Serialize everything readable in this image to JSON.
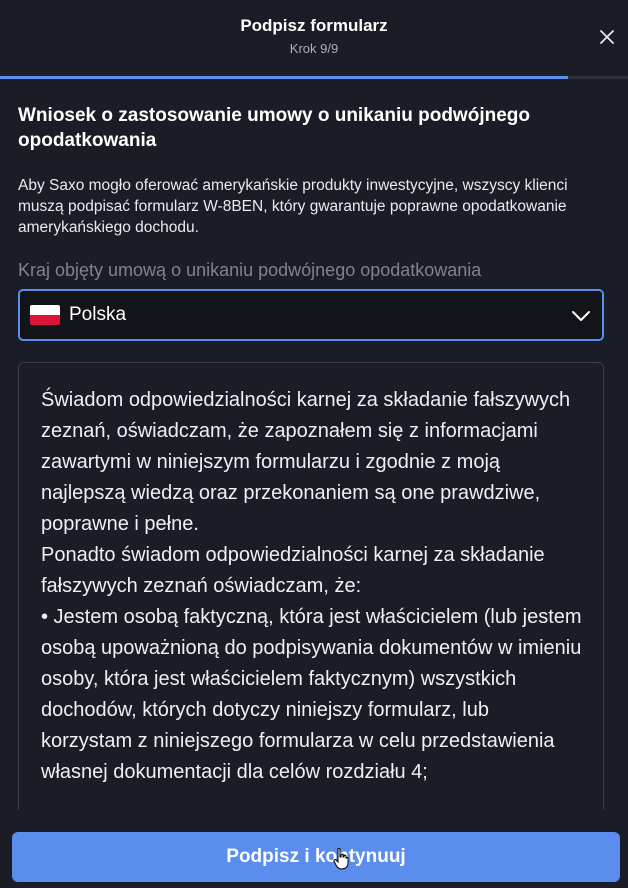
{
  "header": {
    "title": "Podpisz formularz",
    "step": "Krok 9/9"
  },
  "progress": {
    "current_step": 9,
    "total_steps": 9,
    "fill_fraction": 0.905
  },
  "section": {
    "title": "Wniosek o zastosowanie umowy o unikaniu podwójnego opodatkowania",
    "description": "Aby Saxo mogło oferować amerykańskie produkty inwestycyjne, wszyscy klienci muszą podpisać formularz W-8BEN, który gwarantuje poprawne opodatkowanie amerykańskiego dochodu."
  },
  "country_field": {
    "label": "Kraj objęty umową o unikaniu podwójnego opodatkowania",
    "value": "Polska",
    "flag_icon": "poland-flag-icon"
  },
  "declaration": {
    "paragraph1": "Świadom odpowiedzialności karnej za składanie fałszywych zeznań, oświadczam, że zapoznałem się z informacjami zawartymi w niniejszym formularzu i zgodnie z moją najlepszą wiedzą oraz przekonaniem są one prawdziwe, poprawne i pełne.",
    "paragraph2": "Ponadto świadom odpowiedzialności karnej za składanie fałszywych zeznań oświadczam, że:",
    "bullet1": "• Jestem osobą faktyczną, która jest właścicielem (lub jestem osobą upoważnioną do podpisywania dokumentów w imieniu osoby, która jest właścicielem faktycznym) wszystkich dochodów, których dotyczy niniejszy formularz, lub korzystam z niniejszego formularza w celu przedstawienia własnej dokumentacji dla celów rozdziału 4;"
  },
  "footer": {
    "primary_label": "Podpisz i kontynuuj"
  },
  "colors": {
    "background": "#1a1d25",
    "accent": "#5b8def",
    "muted_text": "#7e838d"
  }
}
